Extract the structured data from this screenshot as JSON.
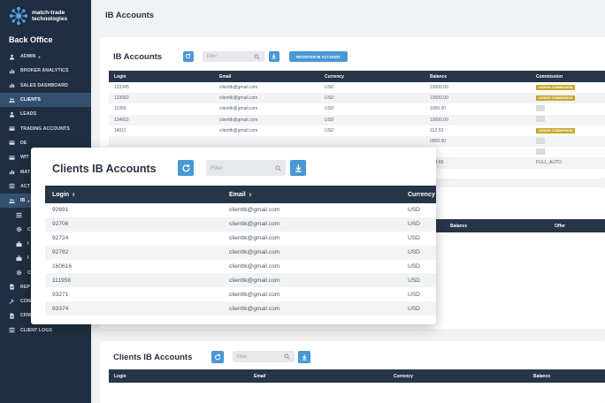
{
  "logo": {
    "line1": "match-trade",
    "line2": "technologies"
  },
  "sidebar": {
    "title": "Back Office",
    "items": [
      {
        "label": "ADMIN",
        "icon": "user-icon",
        "caret": "▾",
        "active": false,
        "sub": false
      },
      {
        "label": "BROKER ANALYTICS",
        "icon": "chart-icon",
        "active": false,
        "sub": false
      },
      {
        "label": "SALES DASHBOARD",
        "icon": "chart-icon",
        "active": false,
        "sub": false
      },
      {
        "label": "CLIENTS",
        "icon": "users-icon",
        "active": true,
        "sub": false
      },
      {
        "label": "LEADS",
        "icon": "user-icon",
        "active": false,
        "sub": false
      },
      {
        "label": "TRADING ACCOUNTS",
        "icon": "card-icon",
        "active": false,
        "sub": false
      },
      {
        "label": "DE",
        "icon": "card-icon",
        "active": false,
        "sub": false
      },
      {
        "label": "WIT",
        "icon": "card-icon",
        "active": false,
        "sub": false
      },
      {
        "label": "MAT",
        "icon": "chart-icon",
        "active": false,
        "sub": false
      },
      {
        "label": "ACT",
        "icon": "list-icon",
        "active": false,
        "sub": false
      },
      {
        "label": "IB",
        "icon": "users-icon",
        "caret": "▾",
        "active": true,
        "sub": false
      },
      {
        "label": "",
        "icon": "list-icon",
        "active": false,
        "sub": true
      },
      {
        "label": "C",
        "icon": "gear-icon",
        "active": false,
        "sub": true
      },
      {
        "label": "I",
        "icon": "briefcase-icon",
        "active": false,
        "sub": true
      },
      {
        "label": "I",
        "icon": "briefcase-icon",
        "active": false,
        "sub": true
      },
      {
        "label": "C",
        "icon": "gear-icon",
        "active": false,
        "sub": true
      },
      {
        "label": "REP",
        "icon": "doc-icon",
        "active": false,
        "sub": false
      },
      {
        "label": "CON",
        "icon": "wrench-icon",
        "active": false,
        "sub": false
      },
      {
        "label": "CRM",
        "icon": "doc-icon",
        "active": false,
        "sub": false
      },
      {
        "label": "CLIENT LOGS",
        "icon": "list-icon",
        "active": false,
        "sub": false
      }
    ]
  },
  "header": {
    "title": "IB Accounts"
  },
  "ib_card": {
    "title": "IB Accounts",
    "filter_placeholder": "Filter",
    "register_label": "REGISTER IB ACCOUNT",
    "columns": [
      "Login",
      "Email",
      "Currency",
      "Balance",
      "Commission"
    ],
    "rows": [
      {
        "login": "123345",
        "email": "clienttk@gmail.com",
        "currency": "USD",
        "balance": "10000.00",
        "commission": "ASSIGN COMMISSION"
      },
      {
        "login": "133682",
        "email": "clienttk@gmail.com",
        "currency": "USD",
        "balance": "10000.00",
        "commission": "ASSIGN COMMISSION"
      },
      {
        "login": "11959",
        "email": "clienttk@gmail.com",
        "currency": "USD",
        "balance": "1000.00",
        "commission": ""
      },
      {
        "login": "134602",
        "email": "clienttk@gmail.com",
        "currency": "USD",
        "balance": "10000.00",
        "commission": ""
      },
      {
        "login": "14011",
        "email": "clienttk@gmail.com",
        "currency": "USD",
        "balance": "312.53",
        "commission": "ASSIGN COMMISSION"
      },
      {
        "login": "",
        "email": "",
        "currency": "",
        "balance": "0000.00",
        "commission": ""
      },
      {
        "login": "",
        "email": "",
        "currency": "",
        "balance": "00",
        "commission": ""
      },
      {
        "login": "",
        "email": "",
        "currency": "",
        "balance": "464.69",
        "commission": "FULL_AUTO"
      }
    ]
  },
  "offers_card": {
    "columns": [
      "Balance",
      "Offer"
    ]
  },
  "bottom_card": {
    "title": "Clients IB Accounts",
    "filter_placeholder": "Filter",
    "columns": [
      "Login",
      "Email",
      "Currency",
      "Balance"
    ]
  },
  "popup": {
    "title": "Clients IB Accounts",
    "filter_placeholder": "Filter",
    "sort_glyph": "⇕",
    "columns": [
      "Login",
      "Email",
      "Currency"
    ],
    "rows": [
      {
        "login": "92691",
        "email": "clienttk@gmail.com",
        "currency": "USD"
      },
      {
        "login": "92706",
        "email": "clienttk@gmail.com",
        "currency": "USD"
      },
      {
        "login": "92724",
        "email": "clienttk@gmail.com",
        "currency": "USD"
      },
      {
        "login": "92782",
        "email": "clienttk@gmail.com",
        "currency": "USD"
      },
      {
        "login": "160616",
        "email": "clienttk@gmail.com",
        "currency": "USD"
      },
      {
        "login": "111958",
        "email": "clienttk@gmail.com",
        "currency": "USD"
      },
      {
        "login": "93271",
        "email": "clienttk@gmail.com",
        "currency": "USD"
      },
      {
        "login": "93374",
        "email": "clienttk@gmail.com",
        "currency": "USD"
      }
    ]
  },
  "colors": {
    "sidebar_bg": "#1f2e42",
    "accent_blue": "#4a97d6",
    "table_header": "#263548",
    "badge_gold": "#c8a62c"
  }
}
